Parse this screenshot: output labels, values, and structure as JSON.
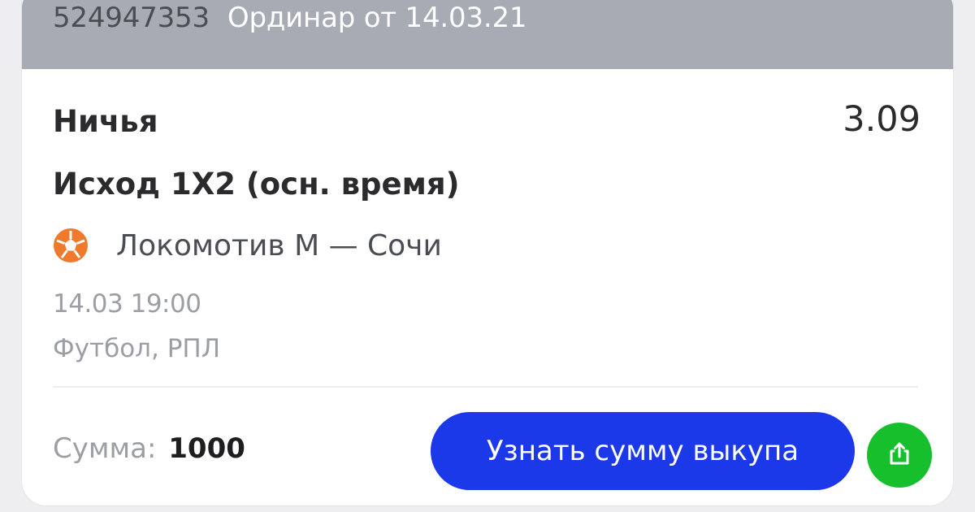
{
  "header": {
    "bet_id": "524947353",
    "bet_type": "Ординар от 14.03.21"
  },
  "bet": {
    "outcome": "Ничья",
    "odds": "3.09",
    "market": "Исход 1X2 (осн. время)",
    "match": "Локомотив М — Сочи",
    "sport_icon": "soccer-ball-icon",
    "datetime": "14.03 19:00",
    "league": "Футбол, РПЛ"
  },
  "footer": {
    "sum_label": "Сумма:",
    "sum_value": "1000",
    "cashout_label": "Узнать сумму выкупа",
    "share_icon": "share-icon"
  },
  "colors": {
    "header_bg": "#a7abb3",
    "cashout_button": "#1b39e8",
    "share_button": "#16c02c",
    "ball_icon": "#f07a2c"
  }
}
